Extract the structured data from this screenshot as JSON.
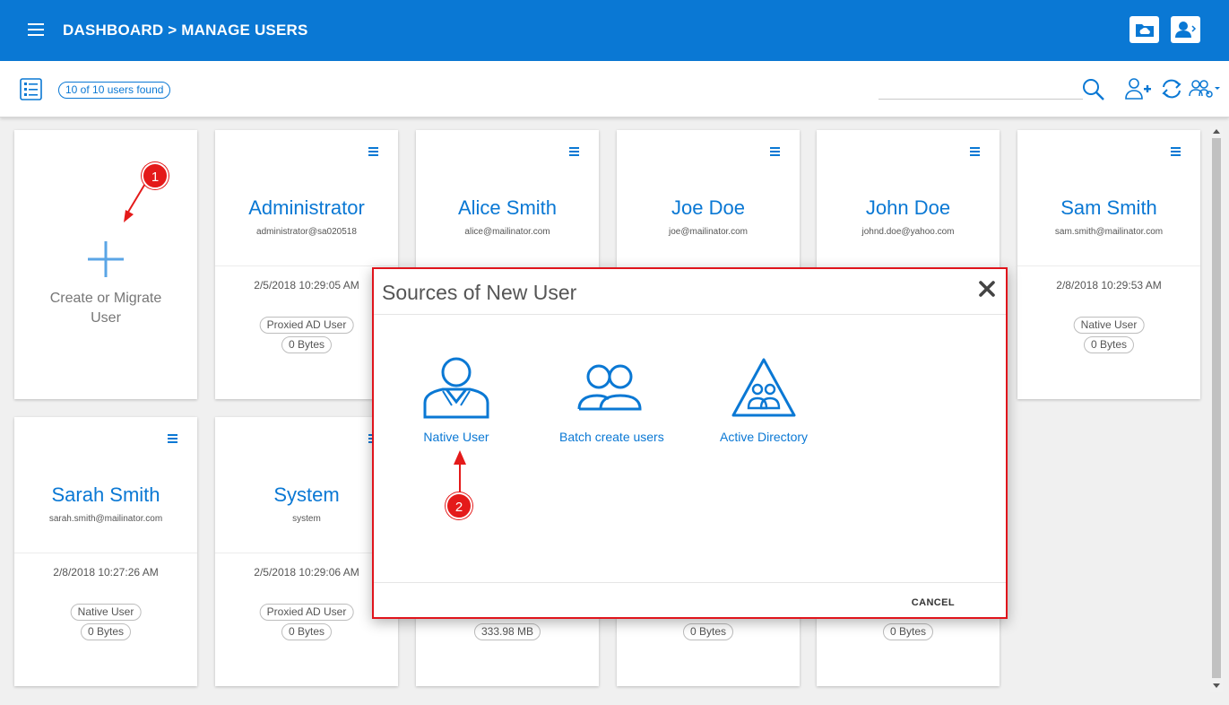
{
  "header": {
    "title": "DASHBOARD > MANAGE USERS",
    "icons": [
      "menu-icon",
      "folder-cloud-icon",
      "user-account-icon"
    ]
  },
  "toolbar": {
    "users_found": "10 of 10 users found",
    "search_placeholder": "",
    "icons": [
      "list-view-icon",
      "search-icon",
      "add-user-icon",
      "sync-icon",
      "group-settings-icon"
    ]
  },
  "create_card": {
    "label_line1": "Create or Migrate",
    "label_line2": "User"
  },
  "users": [
    {
      "name": "Administrator",
      "email": "administrator@sa020518",
      "date": "2/5/2018 10:29:05 AM",
      "type": "Proxied AD User",
      "size": "0 Bytes"
    },
    {
      "name": "Alice Smith",
      "email": "alice@mailinator.com",
      "date": "",
      "type": "",
      "size": ""
    },
    {
      "name": "Joe Doe",
      "email": "joe@mailinator.com",
      "date": "",
      "type": "",
      "size": ""
    },
    {
      "name": "John Doe",
      "email": "johnd.doe@yahoo.com",
      "date": "",
      "type": "",
      "size": ""
    },
    {
      "name": "Sam Smith",
      "email": "sam.smith@mailinator.com",
      "date": "2/8/2018 10:29:53 AM",
      "type": "Native User",
      "size": "0 Bytes"
    },
    {
      "name": "Sarah Smith",
      "email": "sarah.smith@mailinator.com",
      "date": "2/8/2018 10:27:26 AM",
      "type": "Native User",
      "size": "0 Bytes"
    },
    {
      "name": "System",
      "email": "system",
      "date": "2/5/2018 10:29:06 AM",
      "type": "Proxied AD User",
      "size": "0 Bytes"
    },
    {
      "name": "",
      "email": "",
      "date": "",
      "type": "",
      "size": "333.98 MB"
    },
    {
      "name": "",
      "email": "",
      "date": "",
      "type": "",
      "size": "0 Bytes"
    },
    {
      "name": "",
      "email": "",
      "date": "",
      "type": "",
      "size": "0 Bytes"
    }
  ],
  "modal": {
    "title": "Sources of New User",
    "options": [
      {
        "label": "Native User",
        "icon": "native-user-icon"
      },
      {
        "label": "Batch create users",
        "icon": "batch-users-icon"
      },
      {
        "label": "Active Directory",
        "icon": "active-directory-icon"
      }
    ],
    "cancel_label": "CANCEL"
  },
  "annotations": {
    "step1": "1",
    "step2": "2"
  },
  "colors": {
    "brand": "#0a78d4",
    "annotation": "#e41a1a"
  }
}
